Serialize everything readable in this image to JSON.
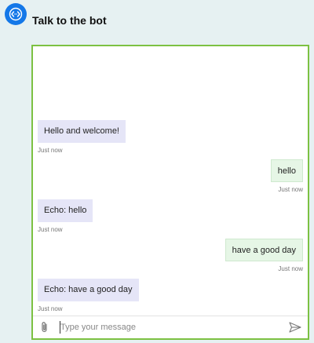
{
  "header": {
    "title": "Talk to the bot",
    "logo_icon": "bot-code-icon",
    "logo_color": "#1478e8"
  },
  "chat": {
    "border_color": "#7cc142",
    "messages": [
      {
        "from": "bot",
        "text": "Hello and welcome!",
        "time": "Just now"
      },
      {
        "from": "user",
        "text": "hello",
        "time": "Just now"
      },
      {
        "from": "bot",
        "text": "Echo: hello",
        "time": "Just now"
      },
      {
        "from": "user",
        "text": "have a good day",
        "time": "Just now"
      },
      {
        "from": "bot",
        "text": "Echo: have a good day",
        "time": "Just now"
      }
    ]
  },
  "input": {
    "placeholder": "Type your message",
    "value": "",
    "attach_icon": "paperclip-icon",
    "send_icon": "send-icon"
  }
}
